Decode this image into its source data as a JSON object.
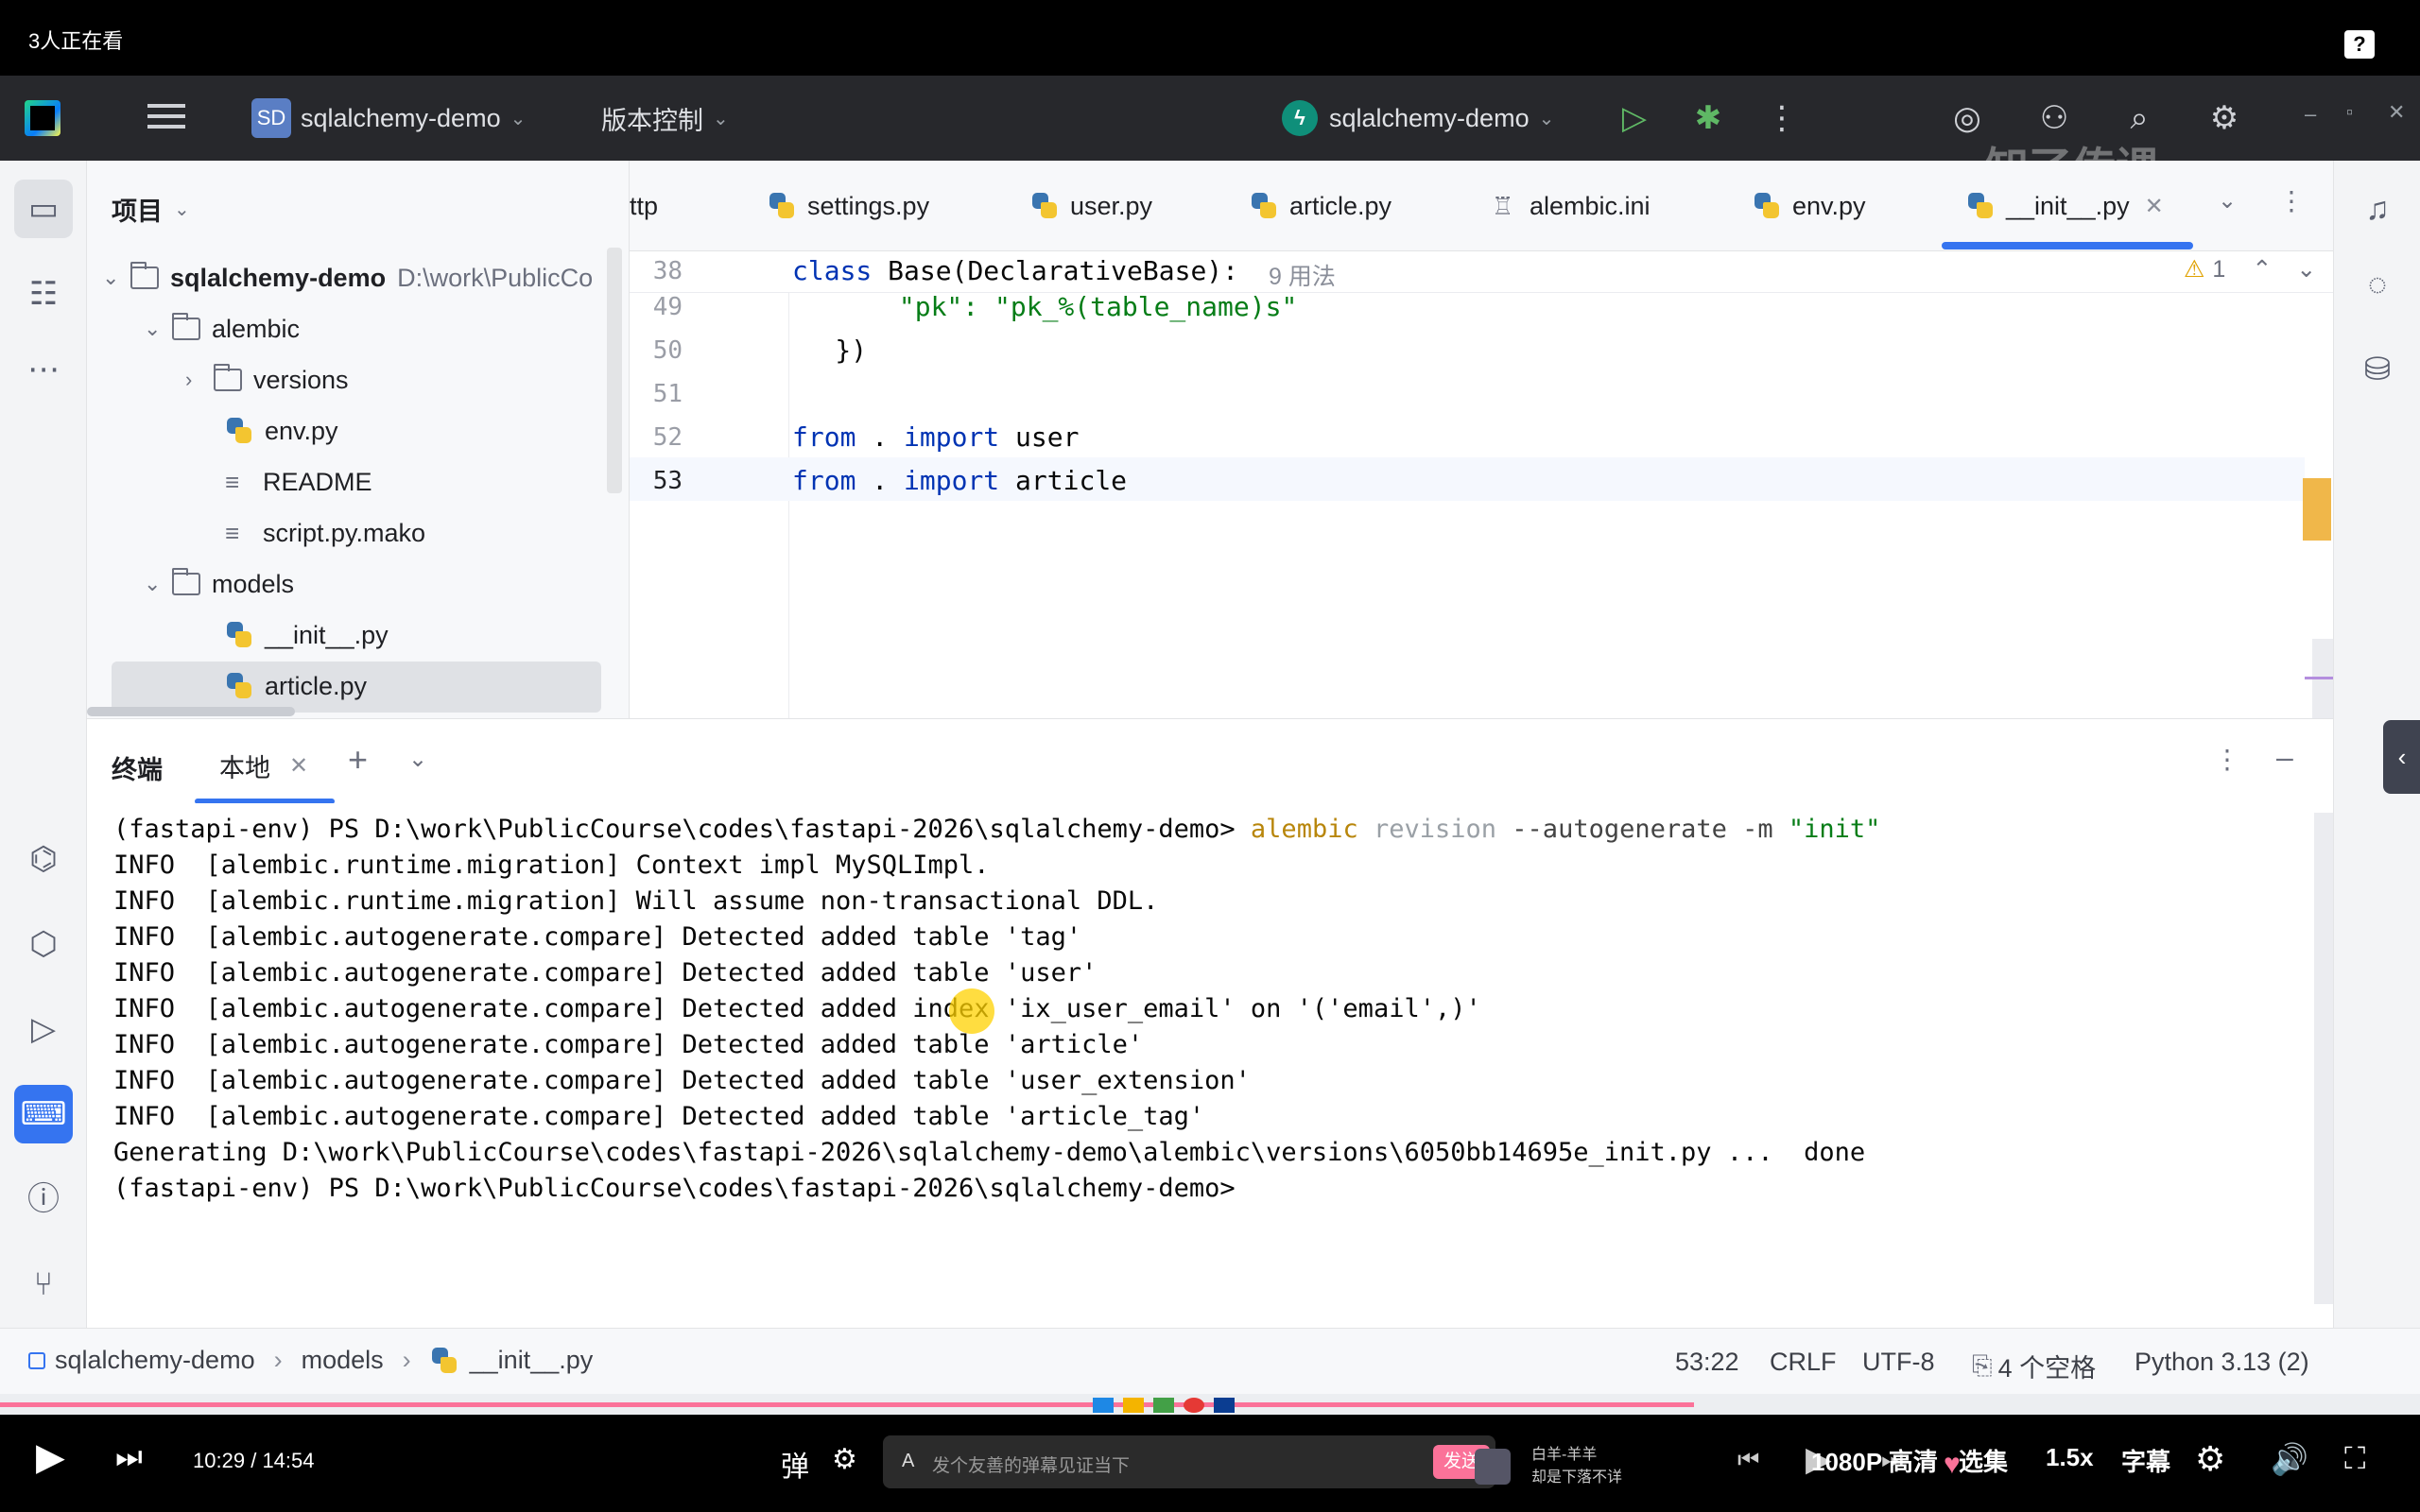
{
  "overlay": {
    "viewer_count": "3人正在看",
    "help": "?"
  },
  "header": {
    "project_badge": "SD",
    "project_name": "sqlalchemy-demo",
    "vcs": "版本控制",
    "run_config": "sqlalchemy-demo",
    "watermark": "知了传课"
  },
  "project_panel": {
    "title": "项目",
    "items": [
      {
        "label": "sqlalchemy-demo",
        "path": "D:\\work\\PublicCo",
        "type": "folder"
      },
      {
        "label": "alembic",
        "type": "folder"
      },
      {
        "label": "versions",
        "type": "folder"
      },
      {
        "label": "env.py",
        "type": "python"
      },
      {
        "label": "README",
        "type": "text"
      },
      {
        "label": "script.py.mako",
        "type": "text"
      },
      {
        "label": "models",
        "type": "folder"
      },
      {
        "label": "__init__.py",
        "type": "python"
      },
      {
        "label": "article.py",
        "type": "python"
      }
    ]
  },
  "tabs": [
    {
      "label": "ttp"
    },
    {
      "label": "settings.py"
    },
    {
      "label": "user.py"
    },
    {
      "label": "article.py"
    },
    {
      "label": "alembic.ini"
    },
    {
      "label": "env.py"
    },
    {
      "label": "__init__.py",
      "active": true
    }
  ],
  "editor": {
    "sticky_line": "38",
    "sticky_kw": "class",
    "sticky_code": " Base(DeclarativeBase):",
    "sticky_usages": "9 用法",
    "warning_count": "1",
    "lines": [
      {
        "num": "49",
        "code": "        \"pk\": \"pk_%(table_name)s\""
      },
      {
        "num": "50",
        "code": "    })"
      },
      {
        "num": "51",
        "code": ""
      },
      {
        "num": "52",
        "kw1": "from",
        "mid": " . ",
        "kw2": "import",
        "rest": " user"
      },
      {
        "num": "53",
        "kw1": "from",
        "mid": " . ",
        "kw2": "import",
        "rest": " article"
      }
    ]
  },
  "terminal": {
    "title": "终端",
    "tab": "本地",
    "prompt": "(fastapi-env) PS D:\\work\\PublicCourse\\codes\\fastapi-2026\\sqlalchemy-demo>",
    "cmd_alembic": "alembic",
    "cmd_revision": "revision",
    "cmd_rest": "--autogenerate -m",
    "cmd_msg": "\"init\"",
    "output": [
      "INFO  [alembic.runtime.migration] Context impl MySQLImpl.",
      "INFO  [alembic.runtime.migration] Will assume non-transactional DDL.",
      "INFO  [alembic.autogenerate.compare] Detected added table 'tag'",
      "INFO  [alembic.autogenerate.compare] Detected added table 'user'",
      "INFO  [alembic.autogenerate.compare] Detected added index 'ix_user_email' on '('email',)'",
      "INFO  [alembic.autogenerate.compare] Detected added table 'article'",
      "INFO  [alembic.autogenerate.compare] Detected added table 'user_extension'",
      "INFO  [alembic.autogenerate.compare] Detected added table 'article_tag'",
      "Generating D:\\work\\PublicCourse\\codes\\fastapi-2026\\sqlalchemy-demo\\alembic\\versions\\6050bb14695e_init.py ...  done",
      "(fastapi-env) PS D:\\work\\PublicCourse\\codes\\fastapi-2026\\sqlalchemy-demo>"
    ]
  },
  "status": {
    "crumb1": "sqlalchemy-demo",
    "crumb2": "models",
    "crumb3": "__init__.py",
    "position": "53:22",
    "line_sep": "CRLF",
    "encoding": "UTF-8",
    "indent": "4 个空格",
    "interpreter": "Python 3.13 (2)"
  },
  "player": {
    "progress": 0.7,
    "time_current": "10:29",
    "time_sep": "/",
    "time_total": "14:54",
    "danmaku_placeholder": "发个友善的弹幕见证当下",
    "send": "发送",
    "user_name": "白羊-羊羊",
    "user_msg": "却是下落不详",
    "quality": "1080P 高清",
    "episodes": "选集",
    "speed": "1.5x",
    "subtitles": "字幕"
  },
  "colors": {
    "accent": "#3574f0",
    "progress": "#fb7299",
    "ide_header": "#27282c"
  }
}
